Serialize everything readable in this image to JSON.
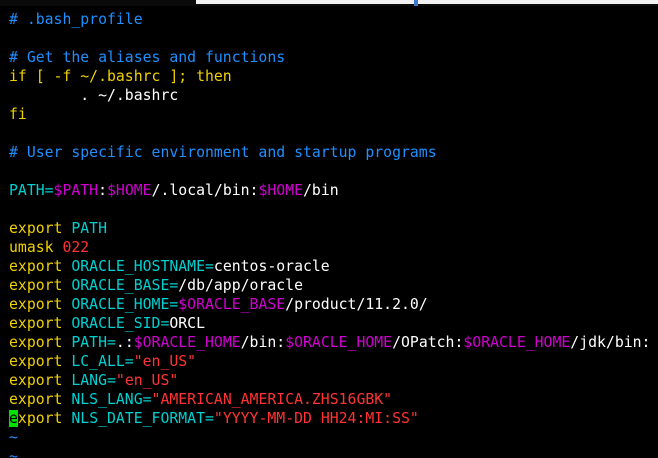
{
  "lines": [
    [
      {
        "t": "# .bash_profile",
        "c": "comment"
      }
    ],
    [],
    [
      {
        "t": "# Get the aliases and functions",
        "c": "comment"
      }
    ],
    [
      {
        "t": "if [ -f ~/.bashrc ]; then",
        "c": "cmd"
      }
    ],
    [
      {
        "t": "        . ~/.bashrc",
        "c": "white"
      }
    ],
    [
      {
        "t": "fi",
        "c": "cmd"
      }
    ],
    [],
    [
      {
        "t": "# User specific environment and startup programs",
        "c": "comment"
      }
    ],
    [],
    [
      {
        "t": "PATH=",
        "c": "cyan"
      },
      {
        "t": "$PATH",
        "c": "var"
      },
      {
        "t": ":",
        "c": "white"
      },
      {
        "t": "$HOME",
        "c": "var"
      },
      {
        "t": "/.local/bin:",
        "c": "white"
      },
      {
        "t": "$HOME",
        "c": "var"
      },
      {
        "t": "/bin",
        "c": "white"
      }
    ],
    [],
    [
      {
        "t": "export ",
        "c": "cmd"
      },
      {
        "t": "PATH",
        "c": "cyan"
      }
    ],
    [
      {
        "t": "umask ",
        "c": "cmd"
      },
      {
        "t": "022",
        "c": "num"
      }
    ],
    [
      {
        "t": "export ",
        "c": "cmd"
      },
      {
        "t": "ORACLE_HOSTNAME=",
        "c": "cyan"
      },
      {
        "t": "centos-oracle",
        "c": "white"
      }
    ],
    [
      {
        "t": "export ",
        "c": "cmd"
      },
      {
        "t": "ORACLE_BASE=",
        "c": "cyan"
      },
      {
        "t": "/db/app/oracle",
        "c": "white"
      }
    ],
    [
      {
        "t": "export ",
        "c": "cmd"
      },
      {
        "t": "ORACLE_HOME=",
        "c": "cyan"
      },
      {
        "t": "$ORACLE_BASE",
        "c": "var"
      },
      {
        "t": "/product/11.2.0/",
        "c": "white"
      }
    ],
    [
      {
        "t": "export ",
        "c": "cmd"
      },
      {
        "t": "ORACLE_SID=",
        "c": "cyan"
      },
      {
        "t": "ORCL",
        "c": "white"
      }
    ],
    [
      {
        "t": "export ",
        "c": "cmd"
      },
      {
        "t": "PATH=",
        "c": "cyan"
      },
      {
        "t": ".:",
        "c": "white"
      },
      {
        "t": "$ORACLE_HOME",
        "c": "var"
      },
      {
        "t": "/bin:",
        "c": "white"
      },
      {
        "t": "$ORACLE_HOME",
        "c": "var"
      },
      {
        "t": "/OPatch:",
        "c": "white"
      },
      {
        "t": "$ORACLE_HOME",
        "c": "var"
      },
      {
        "t": "/jdk/bin:",
        "c": "white"
      }
    ],
    [
      {
        "t": "export ",
        "c": "cmd"
      },
      {
        "t": "LC_ALL=",
        "c": "cyan"
      },
      {
        "t": "\"en_US\"",
        "c": "str"
      }
    ],
    [
      {
        "t": "export ",
        "c": "cmd"
      },
      {
        "t": "LANG=",
        "c": "cyan"
      },
      {
        "t": "\"en_US\"",
        "c": "str"
      }
    ],
    [
      {
        "t": "export ",
        "c": "cmd"
      },
      {
        "t": "NLS_LANG=",
        "c": "cyan"
      },
      {
        "t": "\"AMERICAN_AMERICA.ZHS16GBK\"",
        "c": "str"
      }
    ],
    [
      {
        "t": "e",
        "c": "cursor"
      },
      {
        "t": "xport ",
        "c": "cmd"
      },
      {
        "t": "NLS_DATE_FORMAT=",
        "c": "cyan"
      },
      {
        "t": "\"YYYY-MM-DD HH24:MI:SS\"",
        "c": "str"
      }
    ],
    [
      {
        "t": "~",
        "c": "tilde"
      }
    ],
    [
      {
        "t": "~",
        "c": "tilde"
      }
    ]
  ]
}
